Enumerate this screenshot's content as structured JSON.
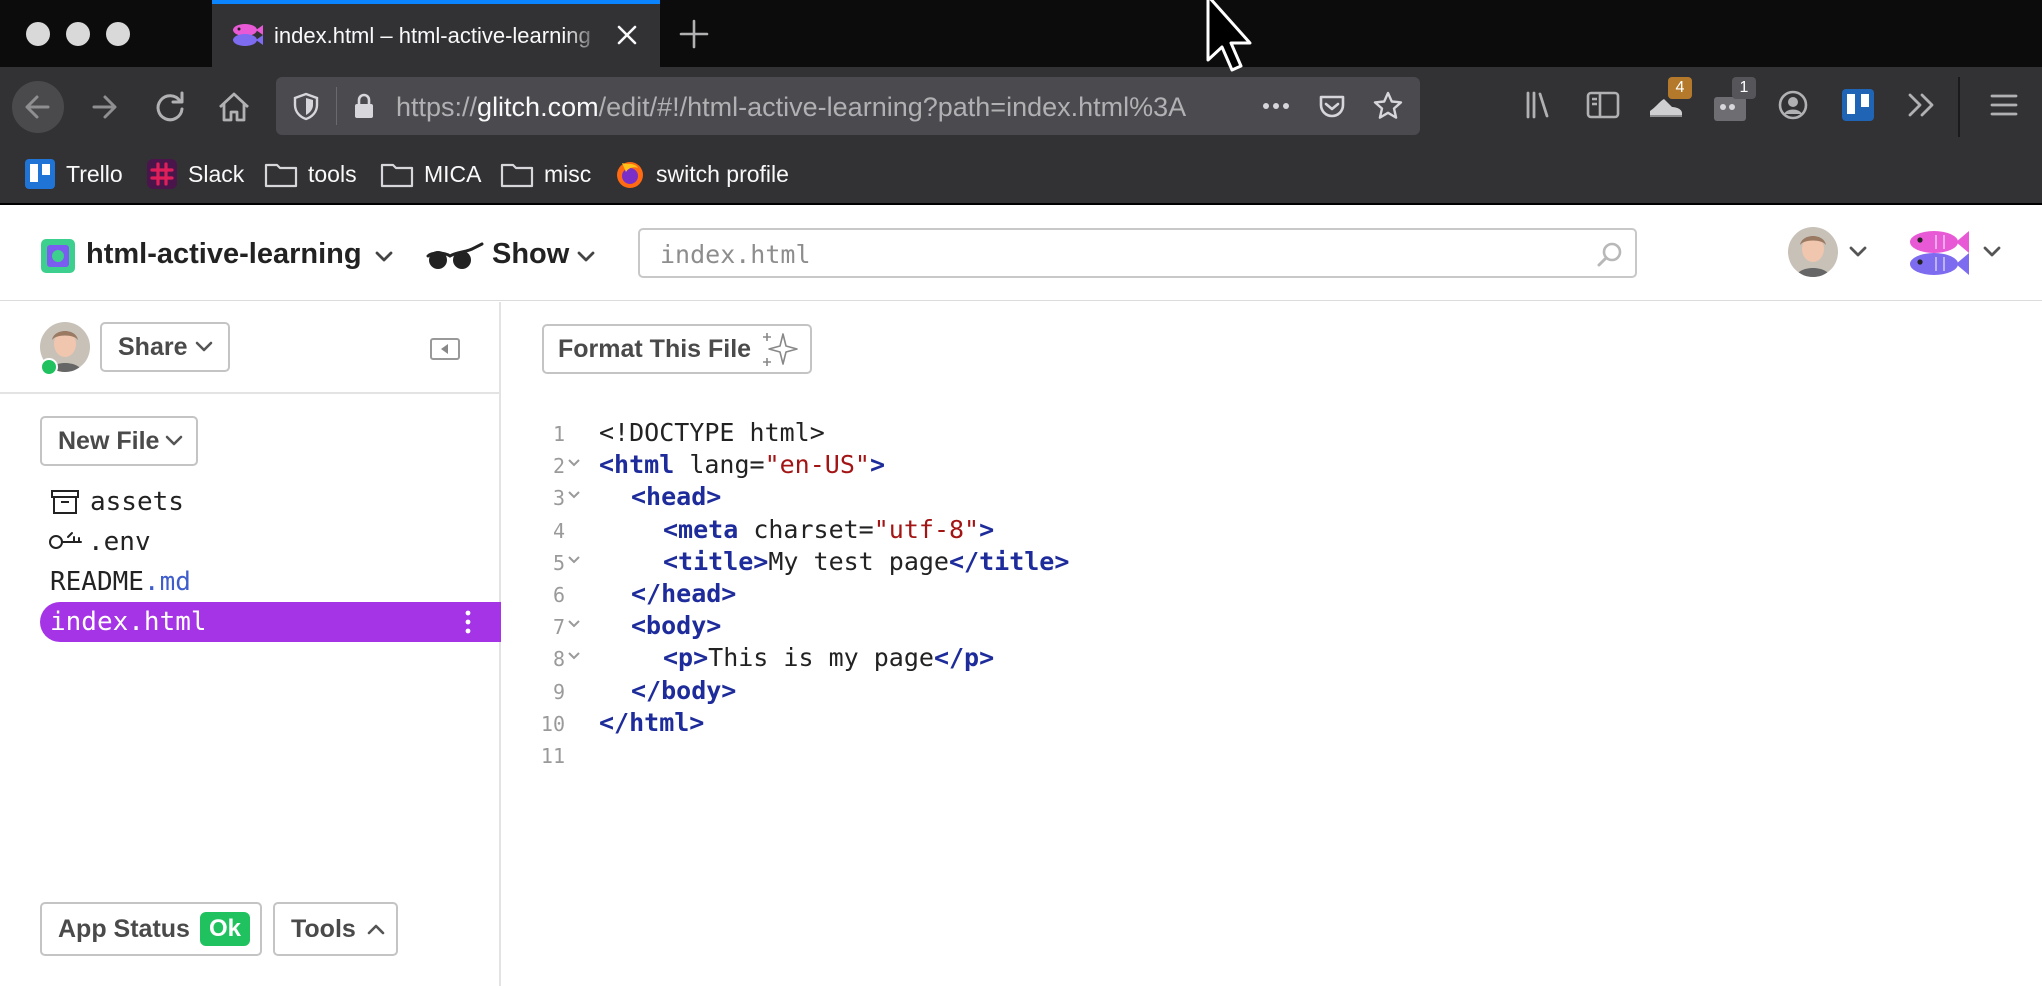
{
  "browser": {
    "tab_title": "index.html – html-active-learning",
    "url_prefix": "https://",
    "url_host": "glitch.com",
    "url_path": "/edit/#!/html-active-learning?path=index.html%3A",
    "badge_extension_count": "4",
    "badge_notes_count": "1",
    "bookmarks": [
      {
        "label": "Trello"
      },
      {
        "label": "Slack"
      },
      {
        "label": "tools"
      },
      {
        "label": "MICA"
      },
      {
        "label": "misc"
      },
      {
        "label": "switch profile"
      }
    ]
  },
  "header": {
    "project_name": "html-active-learning",
    "show_label": "Show",
    "search_value": "index.html"
  },
  "sidebar": {
    "share_label": "Share",
    "new_file_label": "New File",
    "files": [
      {
        "name": "assets",
        "ext": ""
      },
      {
        "name": ".env",
        "ext": ""
      },
      {
        "name": "README",
        "ext": ".md"
      },
      {
        "name": "index.html",
        "ext": ""
      }
    ],
    "app_status_label": "App Status",
    "app_status_value": "Ok",
    "tools_label": "Tools"
  },
  "editor": {
    "format_label": "Format This File",
    "line_numbers": [
      "1",
      "2",
      "3",
      "4",
      "5",
      "6",
      "7",
      "8",
      "9",
      "10",
      "11"
    ],
    "code": {
      "l1": "<!DOCTYPE html>",
      "l2_tag": "<html",
      "l2_attr": " lang=",
      "l2_val": "\"en-US\"",
      "l2_end": ">",
      "l3": "<head>",
      "l4_tag": "<meta",
      "l4_attr": " charset=",
      "l4_val": "\"utf-8\"",
      "l4_end": ">",
      "l5_open": "<title>",
      "l5_text": "My test page",
      "l5_close": "</title>",
      "l6": "</head>",
      "l7": "<body>",
      "l8_open": "<p>",
      "l8_text": "This is my page",
      "l8_close": "</p>",
      "l9": "</body>",
      "l10": "</html>"
    }
  },
  "colors": {
    "selected_file_bg": "#a434e6",
    "status_ok": "#1fc25f",
    "tag": "#1e2c9b",
    "string": "#a31515"
  }
}
